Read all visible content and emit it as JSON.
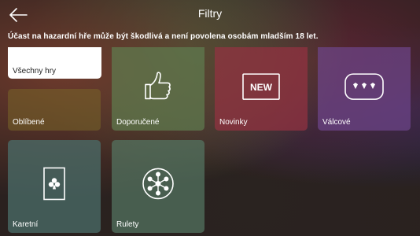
{
  "header": {
    "title": "Filtry",
    "back_icon": "arrow-left-icon"
  },
  "warning": "Účast na hazardní hře může být škodlivá a není povolena osobám mladším 18 let.",
  "tiles": [
    {
      "label": "Všechny hry",
      "icon": "none"
    },
    {
      "label": "Oblíbené",
      "icon": "none"
    },
    {
      "label": "Doporučené",
      "icon": "thumbs-up-icon"
    },
    {
      "label": "Novinky",
      "icon": "new-badge-icon",
      "badge_text": "NEW"
    },
    {
      "label": "Válcové",
      "icon": "slot-reels-icon"
    },
    {
      "label": "Karetní",
      "icon": "playing-card-icon"
    },
    {
      "label": "Rulety",
      "icon": "roulette-wheel-icon"
    }
  ],
  "colors": {
    "text": "#ffffff",
    "selected_tile_bg": "#ffffff",
    "selected_tile_text": "#222222"
  }
}
